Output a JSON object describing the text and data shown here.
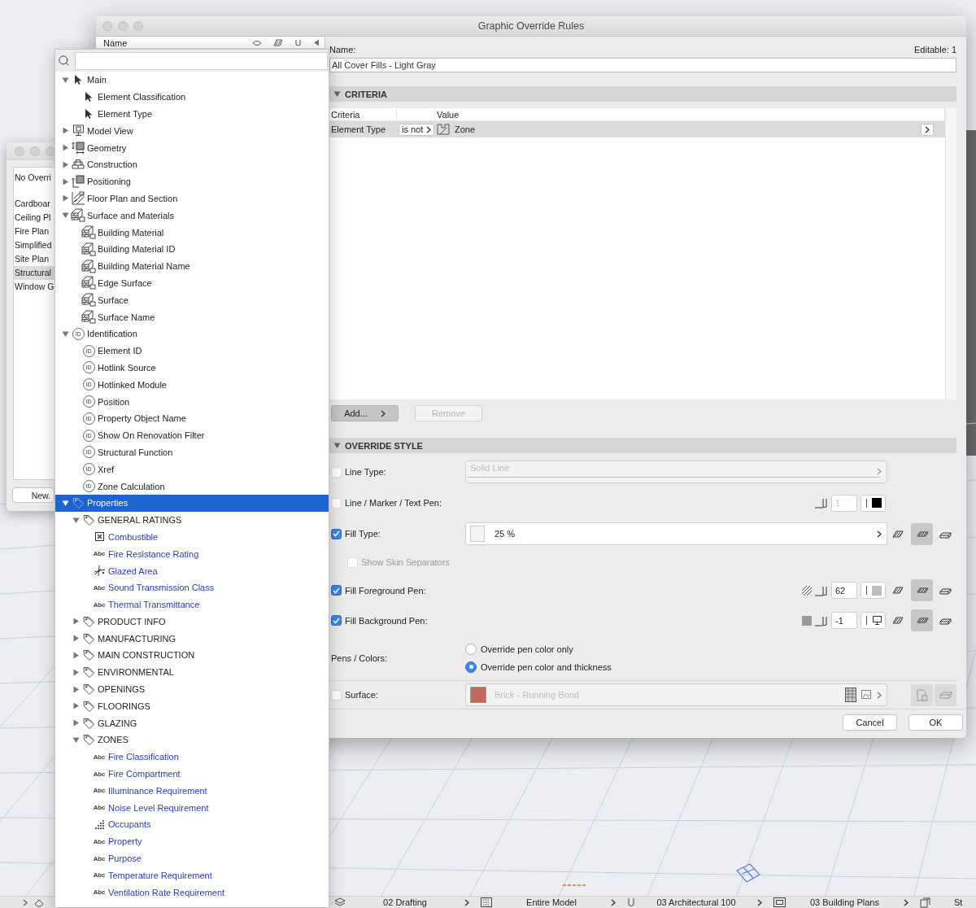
{
  "back_window": {
    "header": "No Overri",
    "items": [
      {
        "label": "Cardboar",
        "selected": false
      },
      {
        "label": "Ceiling Pl",
        "selected": false
      },
      {
        "label": "Fire Plan",
        "selected": false
      },
      {
        "label": "Simplified",
        "selected": false
      },
      {
        "label": "Site Plan",
        "selected": false
      },
      {
        "label": "Structural",
        "selected": true
      },
      {
        "label": "Window G",
        "selected": false
      }
    ],
    "button": "New."
  },
  "dialog": {
    "title": "Graphic Override Rules",
    "list_header": "Name",
    "name_label": "Name:",
    "editable": "Editable: 1",
    "name_value": "All Cover Fills - Light Gray",
    "criteria": {
      "title": "CRITERIA",
      "expanded": true,
      "columns": [
        "Criteria",
        "Value"
      ],
      "rows": [
        {
          "criterion": "Element Type",
          "operator": "is not",
          "value": "Zone",
          "selected": true
        }
      ],
      "buttons": [
        {
          "label": "Add...",
          "disabled": false
        },
        {
          "label": "Remove",
          "disabled": true
        }
      ]
    },
    "override_style": {
      "title": "OVERRIDE STYLE",
      "expanded": true,
      "rows": [
        {
          "kind": "select",
          "label": "Line Type:",
          "checked": false,
          "value": "Solid Line",
          "disabled": true
        },
        {
          "kind": "pen",
          "label": "Line / Marker / Text Pen:",
          "checked": false,
          "value": "1",
          "disabled": true,
          "color": "#000000"
        },
        {
          "kind": "fill",
          "label": "Fill Type:",
          "checked": true,
          "value": "25 %",
          "modes": [
            {
              "selected": false
            },
            {
              "selected": true
            },
            {
              "selected": false
            }
          ]
        },
        {
          "kind": "option",
          "label": "Show Skin Separators",
          "checked": false,
          "disabled": true
        },
        {
          "kind": "foreground",
          "label": "Fill Foreground Pen:",
          "checked": true,
          "value": "62",
          "disabled": false,
          "color": "#bdbdbd",
          "modes": [
            {
              "selected": false
            },
            {
              "selected": true
            },
            {
              "selected": false
            }
          ]
        },
        {
          "kind": "background",
          "label": "Fill Background Pen:",
          "checked": true,
          "value": "-1",
          "disabled": false,
          "modes": [
            {
              "selected": false
            },
            {
              "selected": true
            },
            {
              "selected": false
            }
          ]
        },
        {
          "kind": "radio",
          "label": "Pens / Colors:",
          "options": [
            {
              "label": "Override pen color only",
              "selected": false
            },
            {
              "label": "Override pen color and thickness",
              "selected": true
            }
          ]
        },
        {
          "kind": "surface",
          "label": "Surface:",
          "checked": false,
          "value": "Brick - Running Bond",
          "disabled": true,
          "color": "#c1695b"
        }
      ]
    },
    "buttons": [
      "Cancel",
      "OK"
    ]
  },
  "tree": {
    "items": [
      {
        "label": "Main",
        "kind": "pointer",
        "expanded": true,
        "selected": false,
        "children": [
          {
            "label": "Element Classification",
            "kind": "pointer",
            "selected": false
          },
          {
            "label": "Element Type",
            "kind": "pointer",
            "selected": false
          }
        ]
      },
      {
        "label": "Model View",
        "kind": "model",
        "expanded": false,
        "selected": false
      },
      {
        "label": "Geometry",
        "kind": "geometry",
        "expanded": false,
        "selected": false
      },
      {
        "label": "Construction",
        "kind": "construction",
        "expanded": false,
        "selected": false
      },
      {
        "label": "Positioning",
        "kind": "positioning",
        "expanded": false,
        "selected": false
      },
      {
        "label": "Floor Plan and Section",
        "kind": "floorplan",
        "expanded": false,
        "selected": false
      },
      {
        "label": "Surface and Materials",
        "kind": "material",
        "expanded": true,
        "selected": false,
        "children": [
          {
            "label": "Building Material",
            "kind": "material",
            "selected": false
          },
          {
            "label": "Building Material ID",
            "kind": "material",
            "selected": false
          },
          {
            "label": "Building Material Name",
            "kind": "material",
            "selected": false
          },
          {
            "label": "Edge Surface",
            "kind": "material",
            "selected": false
          },
          {
            "label": "Surface",
            "kind": "material",
            "selected": false
          },
          {
            "label": "Surface Name",
            "kind": "material",
            "selected": false
          }
        ]
      },
      {
        "label": "Identification",
        "kind": "id",
        "badge": "ID",
        "expanded": true,
        "selected": false,
        "children": [
          {
            "label": "Element ID",
            "kind": "id",
            "badge": "ID",
            "selected": false
          },
          {
            "label": "Hotlink Source",
            "kind": "id",
            "badge": "ID",
            "selected": false
          },
          {
            "label": "Hotlinked Module",
            "kind": "id",
            "badge": "ID",
            "selected": false
          },
          {
            "label": "Position",
            "kind": "id",
            "badge": "ID",
            "selected": false
          },
          {
            "label": "Property Object Name",
            "kind": "id",
            "badge": "ID",
            "selected": false
          },
          {
            "label": "Show On Renovation Filter",
            "kind": "id",
            "badge": "ID",
            "selected": false
          },
          {
            "label": "Structural Function",
            "kind": "id",
            "badge": "ID",
            "selected": false
          },
          {
            "label": "Xref",
            "kind": "id",
            "badge": "ID",
            "selected": false
          },
          {
            "label": "Zone Calculation",
            "kind": "id",
            "badge": "ID",
            "selected": false
          }
        ]
      },
      {
        "label": "Properties",
        "kind": "tag",
        "expanded": true,
        "selected": true,
        "children": [
          {
            "label": "GENERAL RATINGS",
            "kind": "tag",
            "expanded": true,
            "selected": false,
            "children": [
              {
                "label": "Combustible",
                "kind": "boolean",
                "custom": true,
                "selected": false
              },
              {
                "label": "Fire Resistance Rating",
                "kind": "text",
                "badge": "Abc",
                "custom": true,
                "selected": false
              },
              {
                "label": "Glazed Area",
                "kind": "area",
                "custom": true,
                "selected": false
              },
              {
                "label": "Sound Transmission Class",
                "kind": "text",
                "badge": "Abc",
                "custom": true,
                "selected": false
              },
              {
                "label": "Thermal Transmittance",
                "kind": "text",
                "badge": "Abc",
                "custom": true,
                "selected": false
              }
            ]
          },
          {
            "label": "PRODUCT INFO",
            "kind": "tag",
            "expanded": false,
            "selected": false
          },
          {
            "label": "MANUFACTURING",
            "kind": "tag",
            "expanded": false,
            "selected": false
          },
          {
            "label": "MAIN CONSTRUCTION",
            "kind": "tag",
            "expanded": false,
            "selected": false
          },
          {
            "label": "ENVIRONMENTAL",
            "kind": "tag",
            "expanded": false,
            "selected": false
          },
          {
            "label": "OPENINGS",
            "kind": "tag",
            "expanded": false,
            "selected": false
          },
          {
            "label": "FLOORINGS",
            "kind": "tag",
            "expanded": false,
            "selected": false
          },
          {
            "label": "GLAZING",
            "kind": "tag",
            "expanded": false,
            "selected": false
          },
          {
            "label": "ZONES",
            "kind": "tag",
            "expanded": true,
            "selected": false,
            "children": [
              {
                "label": "Fire Classification",
                "kind": "text",
                "badge": "Abc",
                "custom": true,
                "selected": false
              },
              {
                "label": "Fire Compartment",
                "kind": "text",
                "badge": "Abc",
                "custom": true,
                "selected": false
              },
              {
                "label": "Illuminance Requirement",
                "kind": "text",
                "badge": "Abc",
                "custom": true,
                "selected": false
              },
              {
                "label": "Noise Level Requirement",
                "kind": "text",
                "badge": "Abc",
                "custom": true,
                "selected": false
              },
              {
                "label": "Occupants",
                "kind": "number",
                "custom": true,
                "selected": false
              },
              {
                "label": "Property",
                "kind": "text",
                "badge": "Abc",
                "custom": true,
                "selected": false
              },
              {
                "label": "Purpose",
                "kind": "text",
                "badge": "Abc",
                "custom": true,
                "selected": false
              },
              {
                "label": "Temperature Requirement",
                "kind": "text",
                "badge": "Abc",
                "custom": true,
                "selected": false
              },
              {
                "label": "Ventilation Rate Requirement",
                "kind": "text",
                "badge": "Abc",
                "custom": true,
                "selected": false
              }
            ]
          }
        ]
      }
    ]
  },
  "status_bar": {
    "items": [
      {
        "label": "02 Drafting",
        "kind": "layers"
      },
      {
        "label": "Entire Model",
        "kind": "pattern"
      },
      {
        "label": "03 Architectural 100",
        "kind": "pen"
      },
      {
        "label": "03 Building Plans",
        "kind": "frame"
      },
      {
        "label": "St",
        "kind": "cube"
      }
    ]
  }
}
